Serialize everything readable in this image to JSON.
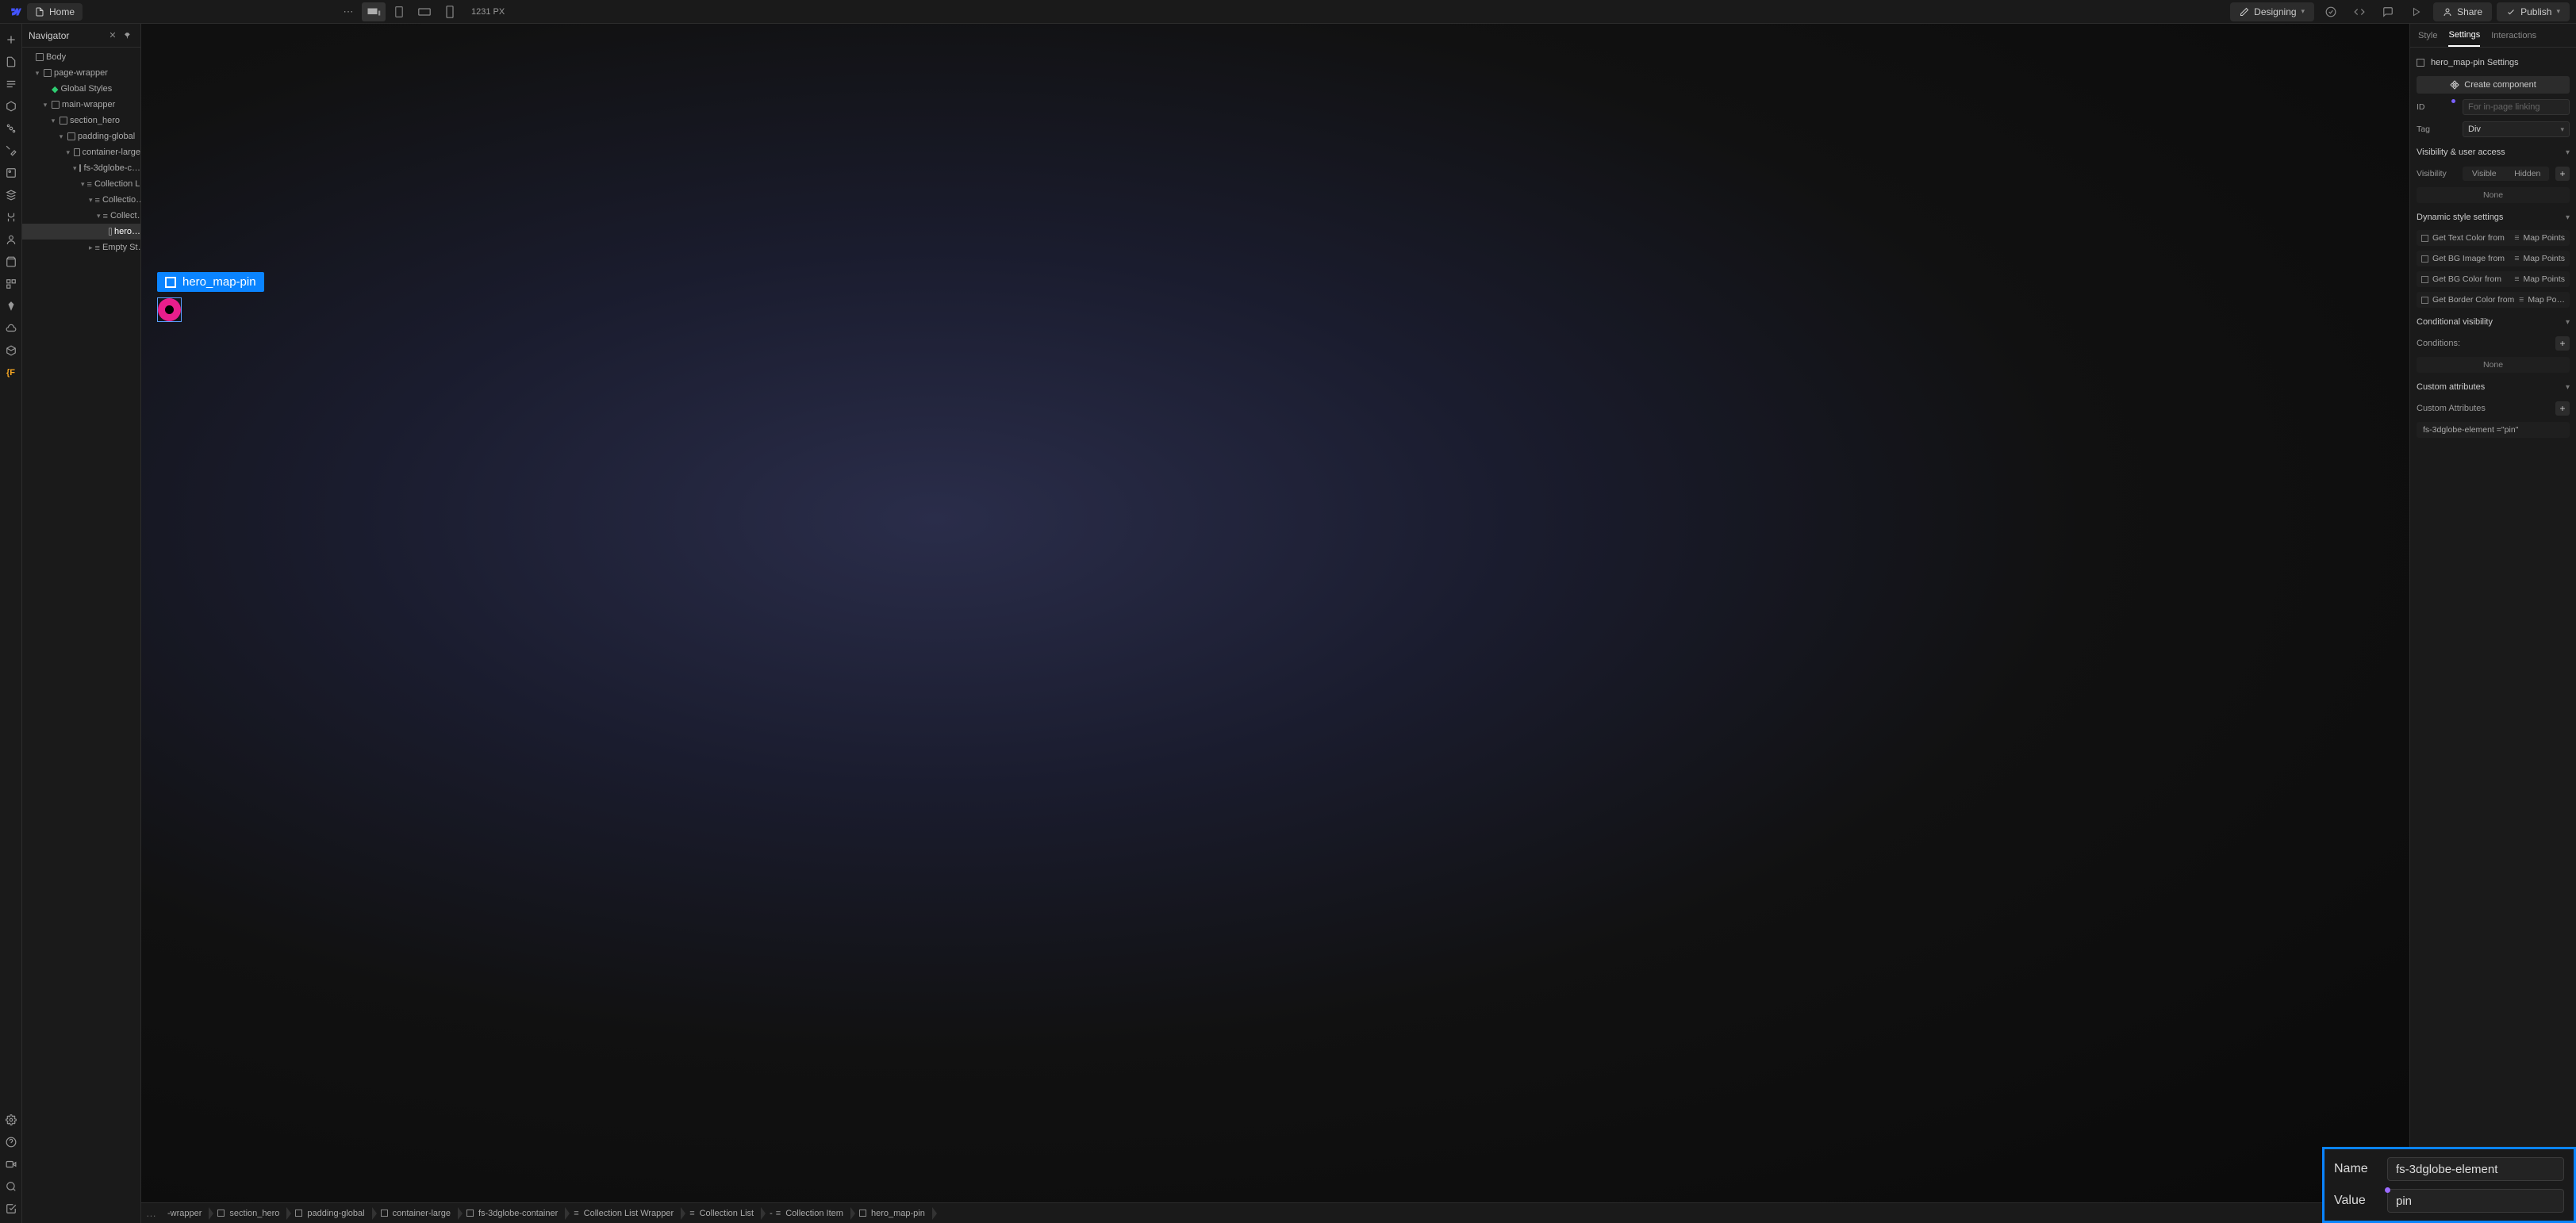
{
  "topbar": {
    "home_label": "Home",
    "viewport_px": "1231 PX",
    "mode_label": "Designing",
    "share_label": "Share",
    "publish_label": "Publish"
  },
  "navigator": {
    "title": "Navigator",
    "tree": [
      {
        "label": "Body",
        "indent": 0,
        "chev": "",
        "icon": "sq"
      },
      {
        "label": "page-wrapper",
        "indent": 1,
        "chev": "▾",
        "icon": "sq"
      },
      {
        "label": "Global Styles",
        "indent": 2,
        "chev": "",
        "icon": "gl"
      },
      {
        "label": "main-wrapper",
        "indent": 2,
        "chev": "▾",
        "icon": "sq"
      },
      {
        "label": "section_hero",
        "indent": 3,
        "chev": "▾",
        "icon": "sq"
      },
      {
        "label": "padding-global",
        "indent": 4,
        "chev": "▾",
        "icon": "sq"
      },
      {
        "label": "container-large",
        "indent": 5,
        "chev": "▾",
        "icon": "sq"
      },
      {
        "label": "fs-3dglobe-c…",
        "indent": 6,
        "chev": "▾",
        "icon": "sq"
      },
      {
        "label": "Collection L…",
        "indent": 7,
        "chev": "▾",
        "icon": "stack"
      },
      {
        "label": "Collectio…",
        "indent": 8,
        "chev": "▾",
        "icon": "stack"
      },
      {
        "label": "Collect…",
        "indent": 9,
        "chev": "▾",
        "icon": "stack"
      },
      {
        "label": "hero…",
        "indent": 10,
        "chev": "",
        "icon": "sq",
        "selected": true
      },
      {
        "label": "Empty St…",
        "indent": 8,
        "chev": "▸",
        "icon": "stack"
      }
    ]
  },
  "canvas": {
    "selection_label": "hero_map-pin"
  },
  "breadcrumbs": [
    {
      "label": "-wrapper",
      "icon": "none"
    },
    {
      "label": "section_hero",
      "icon": "sq"
    },
    {
      "label": "padding-global",
      "icon": "sq"
    },
    {
      "label": "container-large",
      "icon": "sq"
    },
    {
      "label": "fs-3dglobe-container",
      "icon": "sq"
    },
    {
      "label": "Collection List Wrapper",
      "icon": "stack"
    },
    {
      "label": "Collection List",
      "icon": "stack"
    },
    {
      "label": "Collection Item",
      "icon": "stack",
      "prefix": "-"
    },
    {
      "label": "hero_map-pin",
      "icon": "sq"
    }
  ],
  "right": {
    "tabs": {
      "style": "Style",
      "settings": "Settings",
      "interactions": "Interactions"
    },
    "settings_header": "hero_map-pin Settings",
    "create_component": "Create component",
    "id_label": "ID",
    "id_placeholder": "For in-page linking",
    "tag_label": "Tag",
    "tag_value": "Div",
    "visibility_section": "Visibility & user access",
    "visibility_label": "Visibility",
    "visible": "Visible",
    "hidden": "Hidden",
    "none": "None",
    "dynamic_section": "Dynamic style settings",
    "dyn_text": "Get Text Color from",
    "dyn_bgimg": "Get BG Image from",
    "dyn_bgcolor": "Get BG Color from",
    "dyn_border": "Get Border Color from",
    "map_points": "Map Points",
    "map_points_trunc": "Map Po…",
    "conditional_section": "Conditional visibility",
    "conditions_label": "Conditions:",
    "custom_attr_section": "Custom attributes",
    "custom_attr_label": "Custom Attributes",
    "attr_display": "fs-3dglobe-element =\"pin\"",
    "edit": {
      "name_label": "Name",
      "name_value": "fs-3dglobe-element",
      "value_label": "Value",
      "value_value": "pin"
    }
  }
}
